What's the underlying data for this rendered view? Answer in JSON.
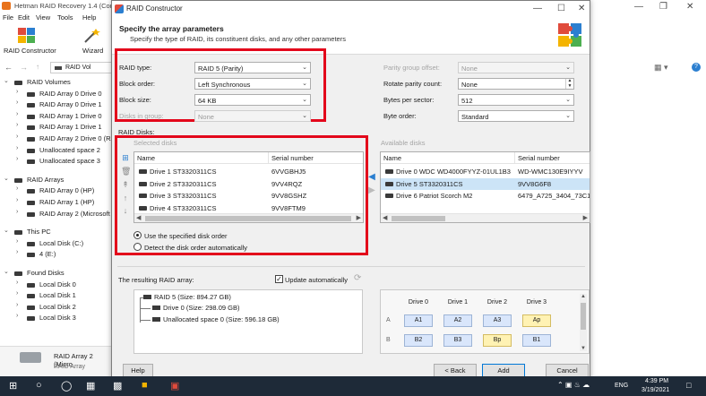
{
  "background_app": {
    "title": "Hetman RAID Recovery 1.4 (Com",
    "menu": [
      "File",
      "Edit",
      "View",
      "Tools",
      "Help"
    ],
    "toolbar": {
      "raid_constructor": "RAID Constructor",
      "wizard": "Wizard"
    },
    "address": "RAID Vol",
    "tree": [
      {
        "label": "RAID Volumes",
        "level": 0,
        "expanded": true
      },
      {
        "label": "RAID Array 0 Drive 0",
        "level": 1
      },
      {
        "label": "RAID Array 0 Drive 1",
        "level": 1
      },
      {
        "label": "RAID Array 1 Drive 0",
        "level": 1
      },
      {
        "label": "RAID Array 1 Drive 1",
        "level": 1
      },
      {
        "label": "RAID Array 2 Drive 0 (RA",
        "level": 1
      },
      {
        "label": "Unallocated space 2",
        "level": 1
      },
      {
        "label": "Unallocated space 3",
        "level": 1
      },
      {
        "label": "RAID Arrays",
        "level": 0,
        "expanded": true
      },
      {
        "label": "RAID Array 0 (HP)",
        "level": 1
      },
      {
        "label": "RAID Array 1 (HP)",
        "level": 1
      },
      {
        "label": "RAID Array 2 (Microsoft",
        "level": 1
      },
      {
        "label": "This PC",
        "level": 0,
        "expanded": true
      },
      {
        "label": "Local Disk (C:)",
        "level": 1
      },
      {
        "label": "4 (E:)",
        "level": 1
      },
      {
        "label": "Found Disks",
        "level": 0,
        "expanded": true
      },
      {
        "label": "Local Disk 0",
        "level": 1
      },
      {
        "label": "Local Disk 1",
        "level": 1
      },
      {
        "label": "Local Disk 2",
        "level": 1
      },
      {
        "label": "Local Disk 3",
        "level": 1
      }
    ],
    "bottom_name": "RAID Array 2 (Micro",
    "bottom_type": "RAID Array"
  },
  "dialog": {
    "title": "RAID Constructor",
    "header_title": "Specify the array parameters",
    "header_subtitle": "Specify the type of RAID, its constituent disks, and any other parameters",
    "params_left": [
      {
        "label": "RAID type:",
        "value": "RAID 5 (Parity)",
        "enabled": true
      },
      {
        "label": "Block order:",
        "value": "Left Synchronous",
        "enabled": true
      },
      {
        "label": "Block size:",
        "value": "64 KB",
        "enabled": true
      },
      {
        "label": "Disks in group:",
        "value": "None",
        "enabled": false
      }
    ],
    "params_right": [
      {
        "label": "Parity group offset:",
        "value": "None",
        "enabled": false,
        "kind": "combo"
      },
      {
        "label": "Rotate parity count:",
        "value": "None",
        "enabled": true,
        "kind": "spin"
      },
      {
        "label": "Bytes per sector:",
        "value": "512",
        "enabled": true,
        "kind": "combo"
      },
      {
        "label": "Byte order:",
        "value": "Standard",
        "enabled": true,
        "kind": "combo"
      }
    ],
    "raid_disks_label": "RAID Disks:",
    "selected_disks_label": "Selected disks",
    "available_disks_label": "Available disks",
    "col_name": "Name",
    "col_serial": "Serial number",
    "selected_disks": [
      {
        "name": "Drive 1 ST3320311CS",
        "serial": "6VVGBHJ5"
      },
      {
        "name": "Drive 2 ST3320311CS",
        "serial": "9VV4RQZ"
      },
      {
        "name": "Drive 3 ST3320311CS",
        "serial": "9VV8GSHZ"
      },
      {
        "name": "Drive 4 ST3320311CS",
        "serial": "9VV8FTM9"
      }
    ],
    "available_disks": [
      {
        "name": "Drive 0 WDC WD4000FYYZ-01UL1B3",
        "serial": "WD-WMC130E9IYYV",
        "selected": false
      },
      {
        "name": "Drive 5 ST3320311CS",
        "serial": "9VV8G6F8",
        "selected": true
      },
      {
        "name": "Drive 6 Patriot Scorch M2",
        "serial": "6479_A725_3404_73C1.",
        "selected": false
      }
    ],
    "radio_specified": "Use the specified disk order",
    "radio_auto": "Detect the disk order automatically",
    "result_label": "The resulting RAID array:",
    "update_auto": "Update automatically",
    "result_tree": [
      "RAID 5 (Size: 894.27 GB)",
      "Drive 0 (Size: 298.09 GB)",
      "Unallocated space 0 (Size: 596.18 GB)"
    ],
    "grid": {
      "headers": [
        "Drive 0",
        "Drive 1",
        "Drive 2",
        "Drive 3"
      ],
      "rows": [
        {
          "label": "A",
          "cells": [
            "A1",
            "A2",
            "A3",
            "Ap"
          ],
          "parity_index": 3
        },
        {
          "label": "B",
          "cells": [
            "B2",
            "B3",
            "Bp",
            "B1"
          ],
          "parity_index": 2
        }
      ]
    },
    "buttons": {
      "help": "Help",
      "back": "< Back",
      "add": "Add",
      "cancel": "Cancel"
    }
  },
  "taskbar": {
    "lang": "ENG",
    "time": "4:39 PM",
    "date": "3/19/2021"
  },
  "colors": {
    "highlight_red": "#e3061b",
    "accent_blue": "#0078d7",
    "parity_yellow": "#fff2b3",
    "block_blue": "#d9e6fb"
  }
}
